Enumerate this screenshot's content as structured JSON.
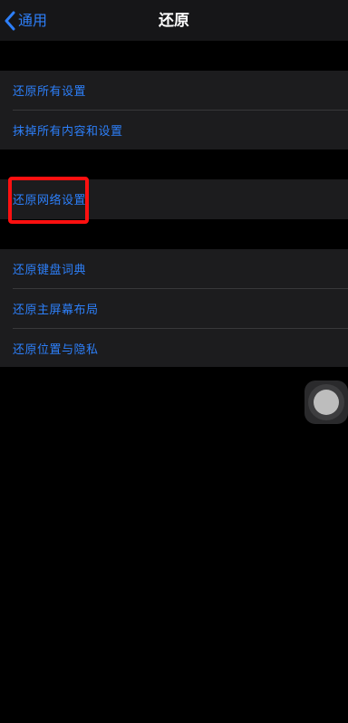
{
  "nav": {
    "back_label": "通用",
    "title": "还原"
  },
  "groups": {
    "reset_all": {
      "items": [
        "还原所有设置",
        "抹掉所有内容和设置"
      ]
    },
    "network": {
      "items": [
        "还原网络设置"
      ]
    },
    "other": {
      "items": [
        "还原键盘词典",
        "还原主屏幕布局",
        "还原位置与隐私"
      ]
    }
  },
  "colors": {
    "accent": "#2d7ff9",
    "highlight": "#ff1010",
    "cell_background": "#1c1c1e",
    "page_background": "#000000"
  }
}
